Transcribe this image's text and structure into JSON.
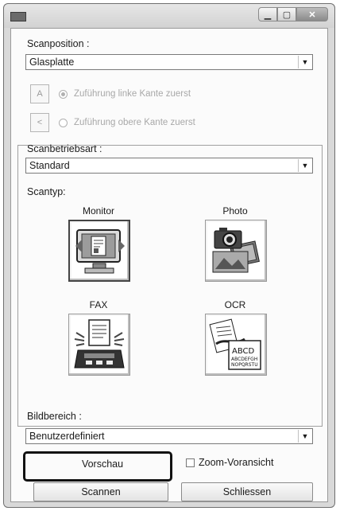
{
  "titlebar": {
    "app_icon": "scanner-app-icon",
    "min": "minimize-icon",
    "max": "maximize-icon",
    "close": "close-icon"
  },
  "scan_position": {
    "label": "Scanposition :",
    "value": "Glasplatte"
  },
  "feed_options": [
    {
      "label": "Zuführung linke Kante zuerst",
      "selected": true,
      "icon_text": "A"
    },
    {
      "label": "Zuführung obere Kante zuerst",
      "selected": false,
      "icon_text": "<"
    }
  ],
  "scan_mode": {
    "label": "Scanbetriebsart :",
    "value": "Standard"
  },
  "scan_type": {
    "label": "Scantyp:",
    "tiles": [
      {
        "label": "Monitor",
        "icon": "monitor-scan-icon",
        "selected": true
      },
      {
        "label": "Photo",
        "icon": "photo-camera-icon",
        "selected": false
      },
      {
        "label": "FAX",
        "icon": "fax-machine-icon",
        "selected": false
      },
      {
        "label": "OCR",
        "icon": "ocr-document-icon",
        "selected": false,
        "sample_text": [
          "ABCD",
          "ABCDEFGH",
          "NOPQRSTU"
        ]
      }
    ]
  },
  "image_area": {
    "label": "Bildbereich :",
    "value": "Benutzerdefiniert"
  },
  "buttons": {
    "preview": "Vorschau",
    "zoom_preview": "Zoom-Voransicht",
    "scan": "Scannen",
    "close": "Schliessen"
  },
  "zoom_preview_checked": false
}
